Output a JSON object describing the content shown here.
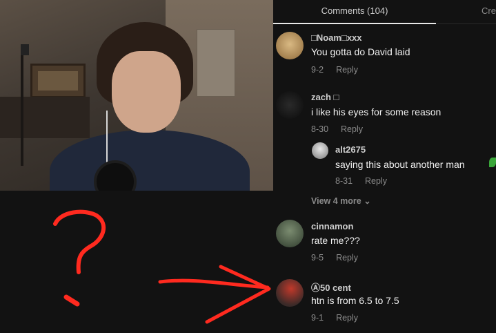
{
  "tabs": {
    "comments": "Comments (104)",
    "other": "Cre"
  },
  "comments": [
    {
      "user": "□Noam□xxx",
      "text": "You gotta do David laid",
      "date": "9-2",
      "reply": "Reply"
    },
    {
      "user": "zach □",
      "text": "i like his eyes for some reason",
      "date": "8-30",
      "reply": "Reply"
    },
    {
      "user": "alt2675",
      "text": "saying this about another man",
      "date": "8-31",
      "reply": "Reply"
    },
    {
      "user": "cinnamon",
      "text": "rate me???",
      "date": "9-5",
      "reply": "Reply"
    },
    {
      "user": "Ⓐ50 cent",
      "text": "htn is from 6.5 to 7.5",
      "date": "9-1",
      "reply": "Reply"
    }
  ],
  "view_more": "View 4 more ⌄",
  "annotation": {
    "color": "#ff2a1f"
  }
}
